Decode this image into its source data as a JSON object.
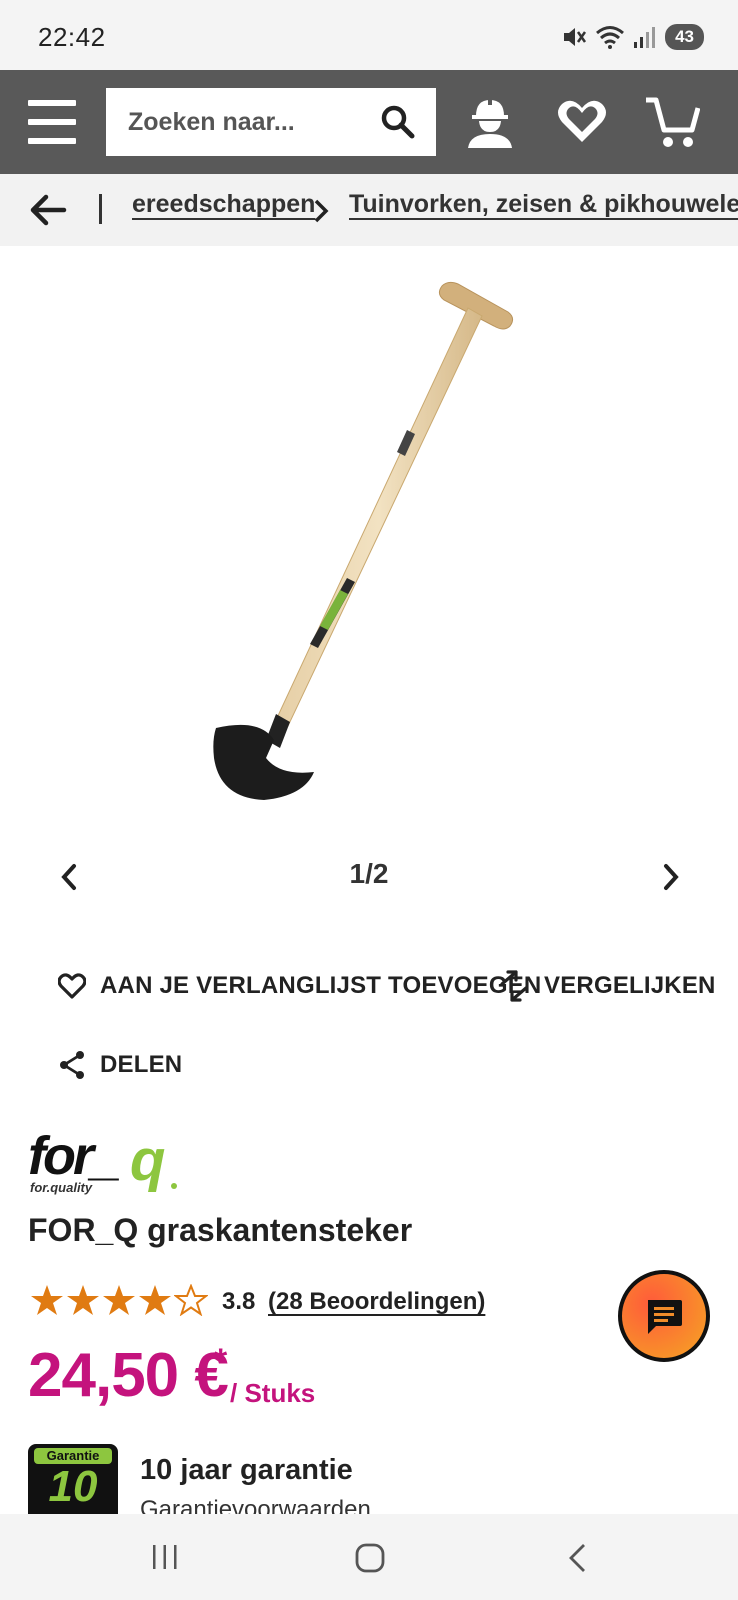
{
  "status_bar": {
    "time": "22:42",
    "battery": "43",
    "icons": [
      "mute-icon",
      "wifi-icon",
      "signal-icon",
      "battery-icon"
    ]
  },
  "header": {
    "search": {
      "placeholder": "Zoeken naar..."
    },
    "icons": [
      "menu-icon",
      "search-icon",
      "account-icon",
      "wishlist-icon",
      "cart-icon"
    ]
  },
  "breadcrumb": {
    "items": [
      "ereedschappen",
      "Tuinvorken, zeisen & pikhouwelen"
    ]
  },
  "gallery": {
    "counter": "1/2",
    "current": 1,
    "total": 2
  },
  "actions": {
    "wishlist": "AAN JE VERLANGLIJST TOEVOEGEN",
    "compare": "VERGELIJKEN",
    "share": "DELEN"
  },
  "brand": {
    "logo_text": "for_q",
    "logo_tagline": "for.quality"
  },
  "product": {
    "title": "FOR_Q graskantensteker",
    "rating_value": "3.8",
    "rating_stars": 3.8,
    "rating_max": 5,
    "rating_count": "(28 Beoordelingen)",
    "price": "24,50 €",
    "price_asterisk": "*",
    "price_unit": "/ Stuks"
  },
  "warranty": {
    "badge_label": "Garantie",
    "badge_number": "10",
    "title": "10 jaar garantie",
    "link": "Garantievoorwaarden"
  },
  "colors": {
    "header_bg": "#595959",
    "price": "#c4137d",
    "star": "#e07b12",
    "brand_green": "#8dc63f"
  }
}
